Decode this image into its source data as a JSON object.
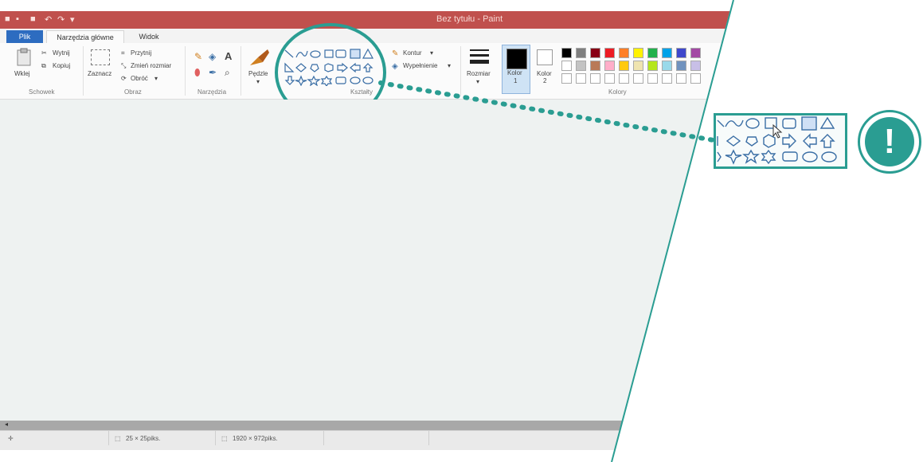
{
  "window": {
    "title": "Bez tytułu - Paint"
  },
  "tabs": {
    "file": "Plik",
    "home": "Narzędzia główne",
    "view": "Widok"
  },
  "clipboard": {
    "paste": "Wklej",
    "cut": "Wytnij",
    "copy": "Kopiuj",
    "group": "Schowek"
  },
  "image": {
    "select": "Zaznacz",
    "crop": "Przytnij",
    "resize": "Zmień rozmiar",
    "rotate": "Obróć",
    "group": "Obraz"
  },
  "tools": {
    "group": "Narzędzia"
  },
  "brushes": {
    "label": "Pędzle"
  },
  "shapes": {
    "outline": "Kontur",
    "fill": "Wypełnienie",
    "group": "Kształty"
  },
  "size": {
    "label": "Rozmiar"
  },
  "colors": {
    "color1": "Kolor",
    "color1_num": "1",
    "color2": "Kolor",
    "color2_num": "2",
    "group": "Kolory",
    "palette_row1": [
      "#000000",
      "#7f7f7f",
      "#880015",
      "#ed1c24",
      "#ff7f27",
      "#fff200",
      "#22b14c",
      "#00a2e8",
      "#3f48cc",
      "#a349a4"
    ],
    "palette_row2": [
      "#ffffff",
      "#c3c3c3",
      "#b97a57",
      "#ffaec9",
      "#ffc90e",
      "#efe4b0",
      "#b5e61d",
      "#99d9ea",
      "#7092be",
      "#c8bfe7"
    ]
  },
  "status": {
    "selection": "25 × 25piks.",
    "canvas": "1920 × 972piks."
  },
  "accent": "#2a9d92",
  "callout": {
    "symbol": "!"
  }
}
